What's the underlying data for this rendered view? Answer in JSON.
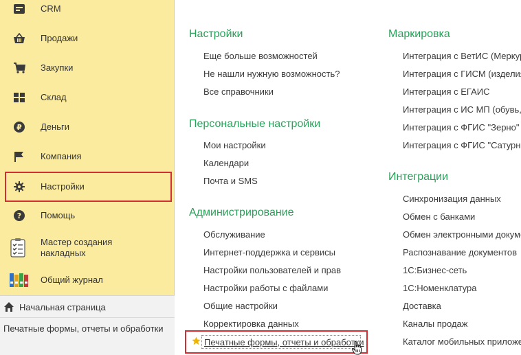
{
  "sidebar": {
    "items": [
      {
        "label": "CRM",
        "icon": "crm-icon"
      },
      {
        "label": "Продажи",
        "icon": "basket-icon"
      },
      {
        "label": "Закупки",
        "icon": "cart-icon"
      },
      {
        "label": "Склад",
        "icon": "warehouse-icon"
      },
      {
        "label": "Деньги",
        "icon": "ruble-icon"
      },
      {
        "label": "Компания",
        "icon": "flag-icon"
      },
      {
        "label": "Настройки",
        "icon": "gear-icon"
      },
      {
        "label": "Помощь",
        "icon": "help-icon"
      },
      {
        "label": "Мастер создания\nнакладных",
        "icon": "checklist-icon"
      },
      {
        "label": "Общий журнал",
        "icon": "binders-icon"
      }
    ],
    "home": "Начальная страница",
    "open_window": "Печатные формы, отчеты и обработки"
  },
  "content": {
    "settings": {
      "title": "Настройки",
      "links": [
        "Еще больше возможностей",
        "Не нашли нужную возможность?",
        "Все справочники"
      ]
    },
    "personal": {
      "title": "Персональные настройки",
      "links": [
        "Мои настройки",
        "Календари",
        "Почта и SMS"
      ]
    },
    "admin": {
      "title": "Администрирование",
      "links": [
        "Обслуживание",
        "Интернет-поддержка и сервисы",
        "Настройки пользователей и прав",
        "Настройки работы с файлами",
        "Общие настройки",
        "Корректировка данных"
      ],
      "favorite": "Печатные формы, отчеты и обработки"
    },
    "marking": {
      "title": "Маркировка",
      "links": [
        "Интеграция с ВетИС (Меркур",
        "Интеграция с ГИСМ (изделия",
        "Интеграция с ЕГАИС",
        "Интеграция с ИС МП (обувь,",
        "Интеграция с ФГИС \"Зерно\"",
        "Интеграция с ФГИС \"Сатурн\""
      ]
    },
    "integrations": {
      "title": "Интеграции",
      "links": [
        "Синхронизация данных",
        "Обмен с банками",
        "Обмен электронными докуме",
        "Распознавание документов",
        "1С:Бизнес-сеть",
        "1С:Номенклатура",
        "Доставка",
        "Каналы продаж",
        "Каталог мобильных приложе"
      ]
    }
  },
  "colors": {
    "sidebar_bg": "#fbeb9f",
    "section_title": "#2aa15a",
    "highlight": "#d22f32",
    "star": "#f0b400"
  }
}
